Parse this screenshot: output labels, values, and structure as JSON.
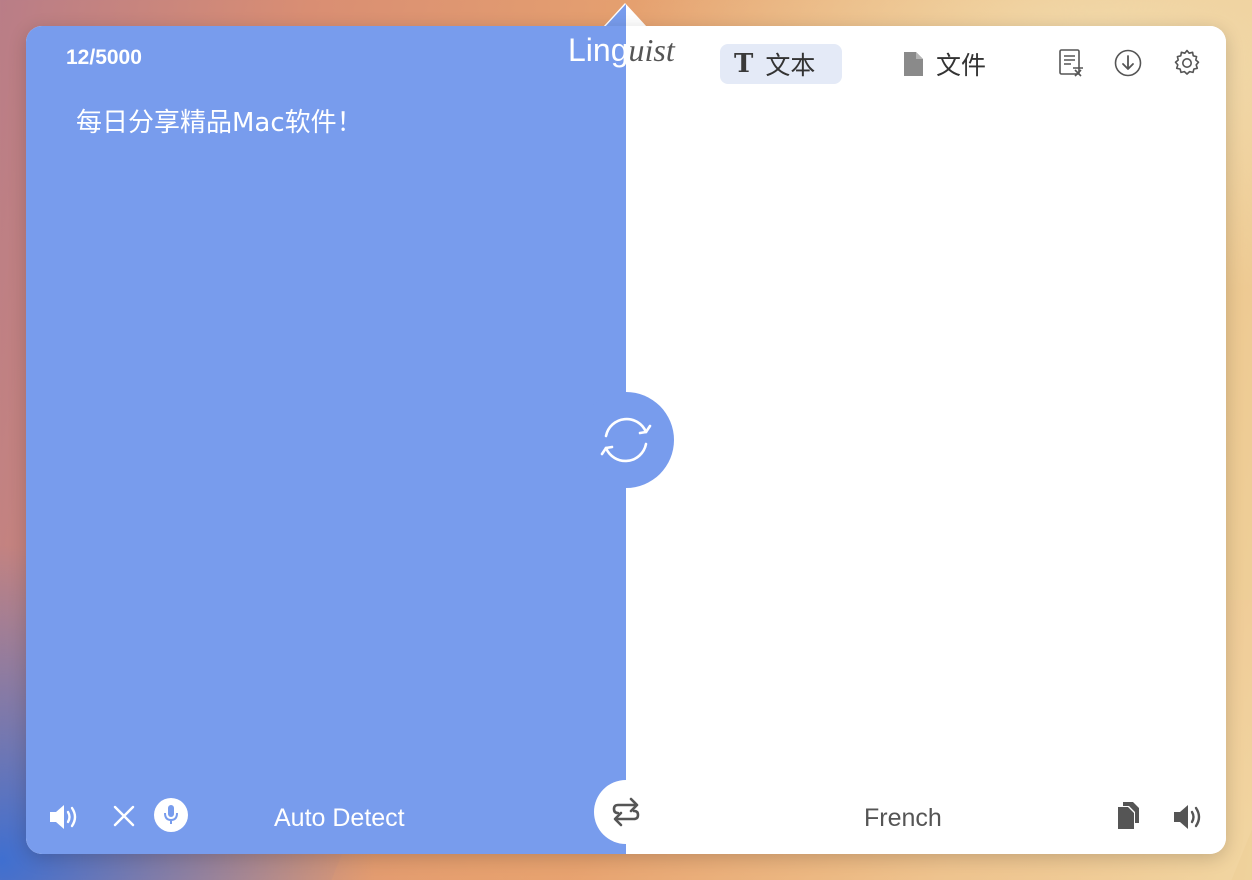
{
  "app": {
    "logo_part1": "Ling",
    "logo_part2": "uist"
  },
  "source": {
    "char_count": "12/5000",
    "text": "每日分享精品Mac软件！",
    "language": "Auto Detect"
  },
  "target": {
    "text": "",
    "language": "French"
  },
  "tabs": [
    {
      "label": "文本",
      "icon": "text-t-icon",
      "selected": true
    },
    {
      "label": "文件",
      "icon": "document-icon",
      "selected": false
    }
  ],
  "toolbar_icons": [
    "history-icon",
    "download-icon",
    "gear-icon"
  ],
  "source_actions": [
    "speaker-icon",
    "close-icon",
    "microphone-icon"
  ],
  "target_actions": [
    "copy-icon",
    "speaker-icon"
  ],
  "center_actions": [
    "sync-icon",
    "swap-icon"
  ],
  "colors": {
    "accent": "#789ced",
    "tab_selected_bg": "#e4eaf7",
    "icon_gray": "#555555"
  }
}
